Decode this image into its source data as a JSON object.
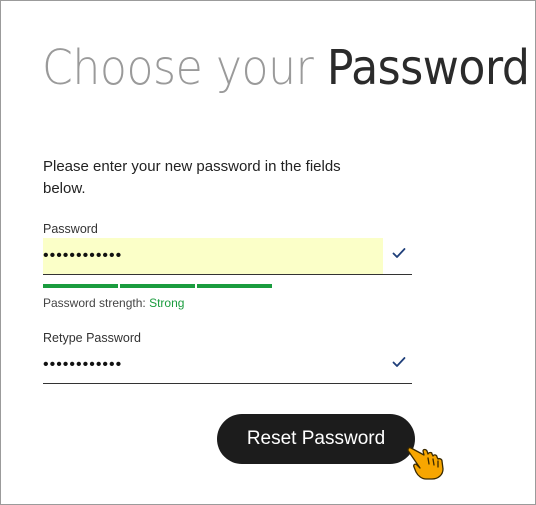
{
  "title": {
    "light": "Choose your ",
    "dark": "Password"
  },
  "intro": "Please enter your new password in the fields below.",
  "password": {
    "label": "Password",
    "value": "••••••••••••"
  },
  "strength": {
    "label": "Password strength:",
    "value": "Strong",
    "level_percent": 100,
    "color": "#1a9c3e"
  },
  "retype": {
    "label": "Retype Password",
    "value": "••••••••••••"
  },
  "submit": {
    "label": "Reset Password"
  },
  "icons": {
    "check": "check-icon",
    "cursor": "hand-pointer-icon"
  },
  "colors": {
    "accent_check": "#1f3f7a",
    "field_autofill": "#fbffc8",
    "button_bg": "#1c1c1c"
  }
}
